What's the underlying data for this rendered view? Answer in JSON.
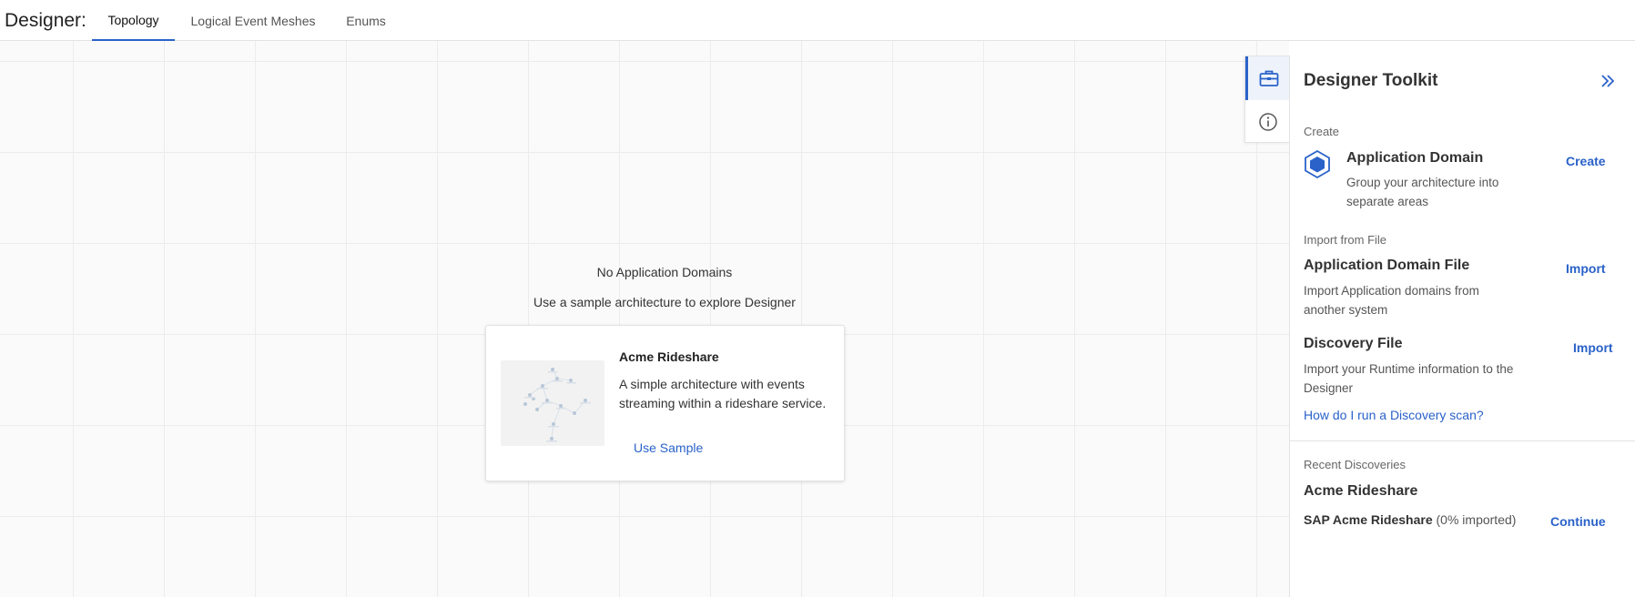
{
  "header": {
    "title": "Designer:",
    "tabs": [
      {
        "label": "Topology",
        "active": true
      },
      {
        "label": "Logical Event Meshes",
        "active": false
      },
      {
        "label": "Enums",
        "active": false
      }
    ]
  },
  "canvas": {
    "empty_title": "No Application Domains",
    "empty_subtitle": "Use a sample architecture to explore Designer",
    "sample_card": {
      "name": "Acme Rideshare",
      "description": "A simple architecture with events streaming within a rideshare service.",
      "action_label": "Use Sample"
    }
  },
  "rail": {
    "items": [
      {
        "icon": "toolkit-icon",
        "active": true
      },
      {
        "icon": "info-icon",
        "active": false
      }
    ]
  },
  "toolkit": {
    "title": "Designer Toolkit",
    "create_section": "Create",
    "app_domain": {
      "title": "Application Domain",
      "description": "Group your architecture into separate areas",
      "action": "Create"
    },
    "import_section": "Import from File",
    "app_domain_file": {
      "title": "Application Domain File",
      "description": "Import Application domains from another system",
      "action": "Import"
    },
    "discovery_file": {
      "title": "Discovery File",
      "description": "Import your Runtime information to the Designer",
      "action": "Import",
      "help_link": "How do I run a Discovery scan?"
    },
    "recent_section": "Recent Discoveries",
    "recent": {
      "title": "Acme Rideshare",
      "name": "SAP Acme Rideshare",
      "status": " (0% imported)",
      "action": "Continue"
    }
  },
  "colors": {
    "accent": "#2a62c9",
    "grid": "#ececec",
    "hex_icon": "#2a62c9"
  }
}
